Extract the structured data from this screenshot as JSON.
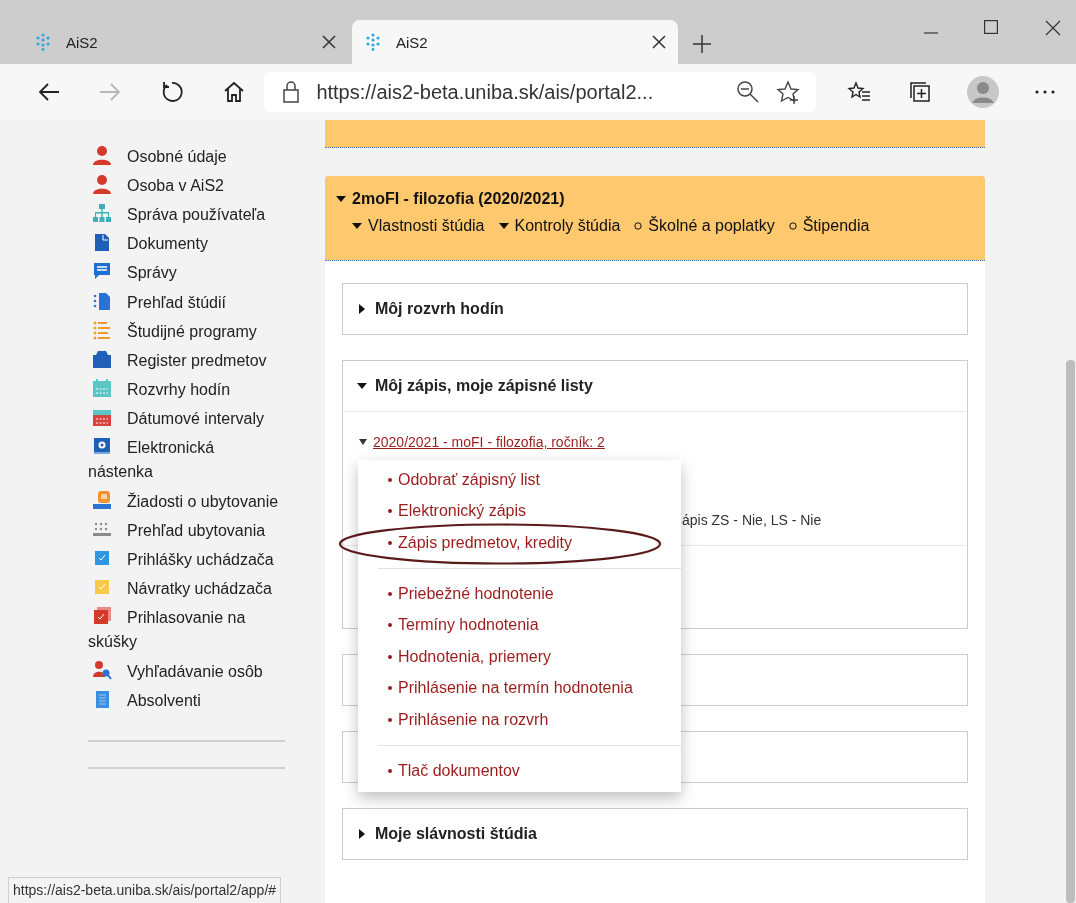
{
  "browser": {
    "tabs": [
      {
        "title": "AiS2",
        "selected": false
      },
      {
        "title": "AiS2",
        "selected": true
      }
    ],
    "address": "https://ais2-beta.uniba.sk/ais/portal2...",
    "forward_disabled": true
  },
  "sidebar": {
    "items": [
      {
        "kind": "person",
        "label": "Osobné údaje"
      },
      {
        "kind": "person",
        "label": "Osoba v AiS2"
      },
      {
        "kind": "org",
        "label": "Správa používateľa"
      },
      {
        "kind": "document",
        "label": "Dokumenty"
      },
      {
        "kind": "message",
        "label": "Správy"
      },
      {
        "kind": "study",
        "label": "Prehľad štúdií"
      },
      {
        "kind": "list",
        "label": "Študijné programy"
      },
      {
        "kind": "briefcase",
        "label": "Register predmetov"
      },
      {
        "kind": "schedule",
        "label": "Rozvrhy hodín"
      },
      {
        "kind": "dates",
        "label": "Dátumové intervaly"
      },
      {
        "kind": "board",
        "label": "Elektronická nástenka"
      },
      {
        "kind": "bed",
        "label": "Žiadosti o ubytovanie"
      },
      {
        "kind": "dots",
        "label": "Prehľad ubytovania"
      },
      {
        "kind": "application",
        "label": "Prihlášky uchádzača"
      },
      {
        "kind": "return",
        "label": "Návratky uchádzača"
      },
      {
        "kind": "exam",
        "label": "Prihlasovanie na skúšky"
      },
      {
        "kind": "search",
        "label": "Vyhľadávanie osôb"
      },
      {
        "kind": "scroll",
        "label": "Absolventi"
      }
    ]
  },
  "study": {
    "title": "2moFI - filozofia (2020/2021)",
    "expanded": true,
    "links": [
      {
        "kind": "dropdown",
        "label": "Vlastnosti štúdia"
      },
      {
        "kind": "dropdown",
        "label": "Kontroly štúdia"
      },
      {
        "kind": "link",
        "label": "Školné a poplatky"
      },
      {
        "kind": "link",
        "label": "Štipendia"
      }
    ]
  },
  "panels": [
    {
      "title": "Môj rozvrh hodín",
      "expanded": false
    },
    {
      "title": "Môj zápis, moje zápisné listy",
      "expanded": true,
      "link": "2020/2021 - moFI - filozofia, ročník: 2",
      "note": "ápis ZS - Nie, LS - Nie"
    },
    {
      "expanded": false
    },
    {
      "expanded": false
    },
    {
      "title": "Moje slávnosti štúdia",
      "expanded": false
    }
  ],
  "menu": {
    "groups": [
      [
        {
          "label": "Odobrať zápisný list",
          "highlighted": false
        },
        {
          "label": "Elektronický zápis",
          "highlighted": false
        },
        {
          "label": "Zápis predmetov, kredity",
          "highlighted": true
        }
      ],
      [
        {
          "label": "Priebežné hodnotenie",
          "highlighted": false
        },
        {
          "label": "Termíny hodnotenia",
          "highlighted": false
        },
        {
          "label": "Hodnotenia, priemery",
          "highlighted": false
        },
        {
          "label": "Prihlásenie na termín hodnotenia",
          "highlighted": false
        },
        {
          "label": "Prihlásenie na rozvrh",
          "highlighted": false
        }
      ],
      [
        {
          "label": "Tlač dokumentov",
          "highlighted": false
        }
      ]
    ]
  },
  "status_bar": "https://ais2-beta.uniba.sk/ais/portal2/app/#"
}
